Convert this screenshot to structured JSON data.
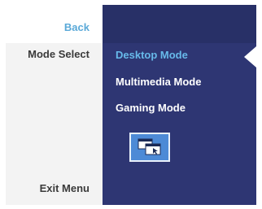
{
  "menu": {
    "back_label": "Back",
    "mode_select_label": "Mode Select",
    "exit_label": "Exit Menu"
  },
  "modes": {
    "options": [
      "Desktop Mode",
      "Multimedia Mode",
      "Gaming Mode"
    ],
    "selected_index": 0,
    "selected_icon": "desktop-windows-icon"
  },
  "colors": {
    "panel_blue": "#2e3673",
    "selected_text": "#67b9ea",
    "back_text": "#5aa9d8",
    "icon_box": "#4d8ad6"
  }
}
